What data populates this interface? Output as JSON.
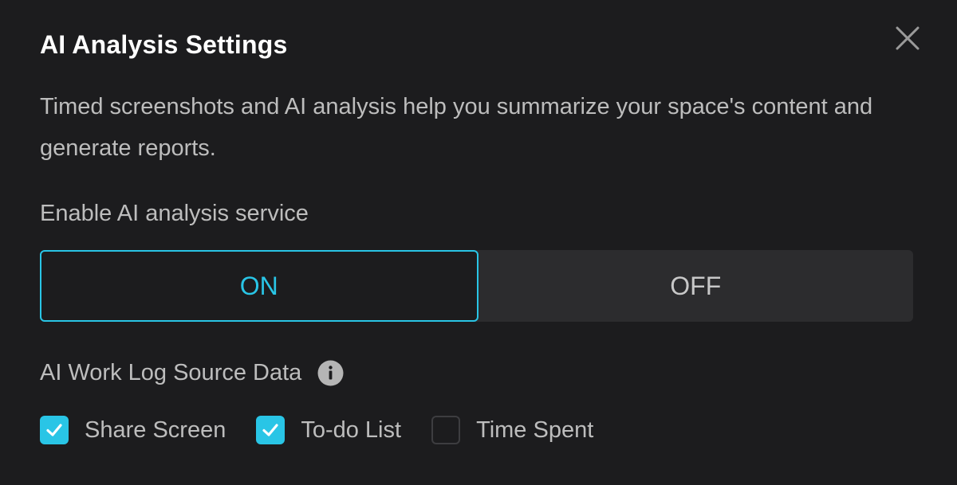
{
  "dialog": {
    "title": "AI Analysis Settings",
    "description": "Timed screenshots and AI analysis help you summarize your space's content and generate reports.",
    "close_icon": "close-icon"
  },
  "enable_service": {
    "label": "Enable AI analysis service",
    "options": [
      "ON",
      "OFF"
    ],
    "selected": "ON"
  },
  "source_data": {
    "label": "AI Work Log Source Data",
    "info_icon": "info-icon",
    "items": [
      {
        "label": "Share Screen",
        "checked": true
      },
      {
        "label": "To-do List",
        "checked": true
      },
      {
        "label": "Time Spent",
        "checked": false
      }
    ]
  },
  "colors": {
    "accent": "#29c5e6",
    "background": "#1c1c1e",
    "segment_bg": "#2c2c2e"
  }
}
